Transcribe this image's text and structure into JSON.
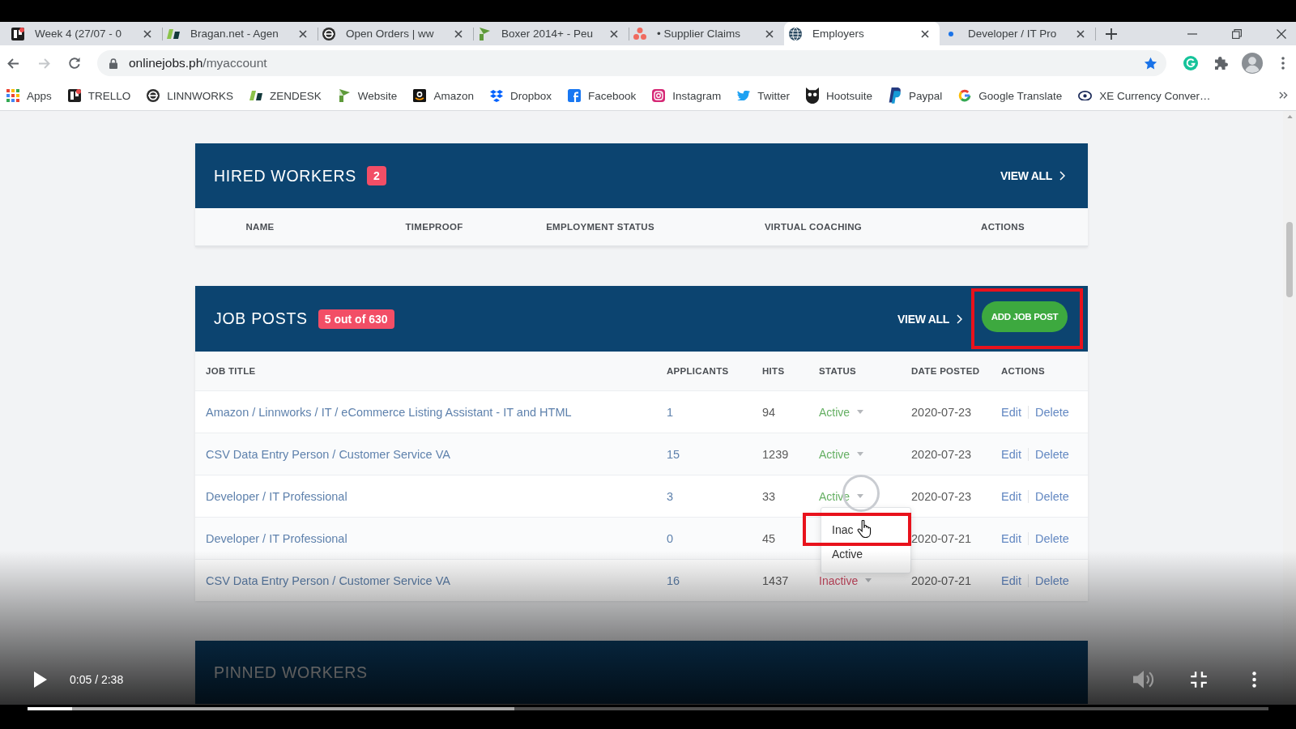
{
  "browser": {
    "tabs": [
      {
        "title": "Week 4 (27/07 - 0",
        "selected": false
      },
      {
        "title": "Bragan.net - Agen",
        "selected": false
      },
      {
        "title": "Open Orders | ww",
        "selected": false
      },
      {
        "title": "Boxer 2014+ - Peu",
        "selected": false
      },
      {
        "title": "• Supplier Claims",
        "selected": false
      },
      {
        "title": "Employers",
        "selected": true
      },
      {
        "title": "Developer / IT Pro",
        "selected": false
      }
    ],
    "nav": {
      "back_disabled": false,
      "forward_disabled": true
    },
    "address": {
      "host": "onlinejobs.ph",
      "path": "/myaccount"
    },
    "bookmarked": true,
    "bookmarks": [
      "Apps",
      "TRELLO",
      "LINNWORKS",
      "ZENDESK",
      "Website",
      "Amazon",
      "Dropbox",
      "Facebook",
      "Instagram",
      "Twitter",
      "Hootsuite",
      "Paypal",
      "Google Translate",
      "XE Currency Conver…"
    ]
  },
  "page": {
    "hired_workers": {
      "title": "HIRED WORKERS",
      "count": "2",
      "view_all": "VIEW ALL",
      "columns": [
        "NAME",
        "TIMEPROOF",
        "EMPLOYMENT STATUS",
        "VIRTUAL COACHING",
        "ACTIONS"
      ]
    },
    "job_posts": {
      "title": "JOB POSTS",
      "count": "5 out of 630",
      "view_all": "VIEW ALL",
      "add_button": {
        "label": "ADD JOB POST",
        "highlighted": true
      },
      "columns": [
        "JOB TITLE",
        "APPLICANTS",
        "HITS",
        "STATUS",
        "DATE POSTED",
        "ACTIONS"
      ],
      "rows": [
        {
          "title": "Amazon / Linnworks / IT / eCommerce Listing Assistant - IT and HTML",
          "applicants": "1",
          "hits": "94",
          "status": {
            "label": "Active",
            "active": true,
            "open": false
          },
          "date": "2020-07-23",
          "actions": [
            "Edit",
            "Delete"
          ]
        },
        {
          "title": "CSV Data Entry Person / Customer Service VA",
          "applicants": "15",
          "hits": "1239",
          "status": {
            "label": "Active",
            "active": true,
            "open": false
          },
          "date": "2020-07-23",
          "actions": [
            "Edit",
            "Delete"
          ]
        },
        {
          "title": "Developer / IT Professional",
          "applicants": "3",
          "hits": "33",
          "status": {
            "label": "Active",
            "active": true,
            "open": true,
            "menu": [
              {
                "label": "Inac",
                "highlighted": true
              },
              {
                "label": "Active",
                "highlighted": false
              }
            ]
          },
          "date": "2020-07-23",
          "actions": [
            "Edit",
            "Delete"
          ]
        },
        {
          "title": "Developer / IT Professional",
          "applicants": "0",
          "hits": "45",
          "date": "2020-07-21",
          "actions": [
            "Edit",
            "Delete"
          ]
        },
        {
          "title": "CSV Data Entry Person / Customer Service VA",
          "applicants": "16",
          "hits": "1437",
          "status": {
            "label": "Inactive",
            "active": false,
            "open": false
          },
          "date": "2020-07-21",
          "actions": [
            "Edit",
            "Delete"
          ]
        }
      ]
    },
    "pinned_workers": {
      "title": "PINNED WORKERS"
    }
  },
  "video": {
    "playing": false,
    "fullscreen": true,
    "time": "0:05 / 2:38",
    "progress": {
      "level": 0.036,
      "buffered": {
        "level": 0.392
      }
    }
  }
}
